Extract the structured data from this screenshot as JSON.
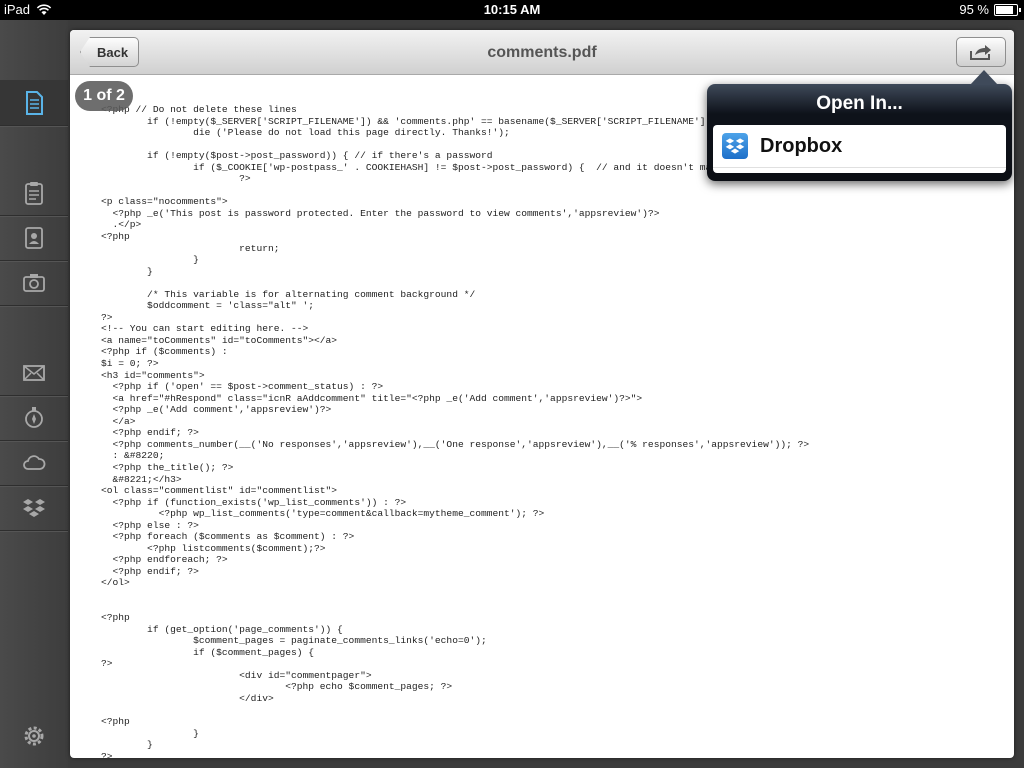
{
  "status_bar": {
    "device": "iPad",
    "time": "10:15 AM",
    "battery": "95 %",
    "battery_level": 0.95
  },
  "sidebar": {
    "items": [
      "document-icon",
      "clipboard-icon",
      "contacts-icon",
      "camera-icon",
      "mail-icon",
      "compass-icon",
      "cloud-icon",
      "dropbox-icon",
      "gear-icon"
    ]
  },
  "nav": {
    "back_label": "Back",
    "title": "comments.pdf",
    "action_icon": "share-icon"
  },
  "viewer": {
    "page_indicator": "1 of 2"
  },
  "popover": {
    "title": "Open In...",
    "items": [
      {
        "label": "Dropbox",
        "icon": "dropbox-icon"
      }
    ]
  },
  "document": {
    "lines": [
      "<?php // Do not delete these lines",
      "        if (!empty($_SERVER['SCRIPT_FILENAME']) && 'comments.php' == basename($_SERVER['SCRIPT_FILENAME']))",
      "                die ('Please do not load this page directly. Thanks!');",
      "",
      "        if (!empty($post->post_password)) { // if there's a password",
      "                if ($_COOKIE['wp-postpass_' . COOKIEHASH] != $post->post_password) {  // and it doesn't match the cookie",
      "                        ?>",
      "",
      "<p class=\"nocomments\">",
      "  <?php _e('This post is password protected. Enter the password to view comments','appsreview')?>",
      "  .</p>",
      "<?php",
      "                        return;",
      "                }",
      "        }",
      "",
      "        /* This variable is for alternating comment background */",
      "        $oddcomment = 'class=\"alt\" ';",
      "?>",
      "<!-- You can start editing here. -->",
      "<a name=\"toComments\" id=\"toComments\"></a>",
      "<?php if ($comments) :",
      "$i = 0; ?>",
      "<h3 id=\"comments\">",
      "  <?php if ('open' == $post->comment_status) : ?>",
      "  <a href=\"#hRespond\" class=\"icnR aAddcomment\" title=\"<?php _e('Add comment','appsreview')?>\">",
      "  <?php _e('Add comment','appsreview')?>",
      "  </a>",
      "  <?php endif; ?>",
      "  <?php comments_number(__('No responses','appsreview'),__('One response','appsreview'),__('% responses','appsreview')); ?>",
      "  : &#8220;",
      "  <?php the_title(); ?>",
      "  &#8221;</h3>",
      "<ol class=\"commentlist\" id=\"commentlist\">",
      "  <?php if (function_exists('wp_list_comments')) : ?>",
      "          <?php wp_list_comments('type=comment&callback=mytheme_comment'); ?>",
      "  <?php else : ?>",
      "  <?php foreach ($comments as $comment) : ?>",
      "        <?php listcomments($comment);?>",
      "  <?php endforeach; ?>",
      "  <?php endif; ?>",
      "</ol>",
      "",
      "",
      "<?php",
      "        if (get_option('page_comments')) {",
      "                $comment_pages = paginate_comments_links('echo=0');",
      "                if ($comment_pages) {",
      "?>",
      "                        <div id=\"commentpager\">",
      "                                <?php echo $comment_pages; ?>",
      "                        </div>",
      "",
      "<?php",
      "                }",
      "        }",
      "?>"
    ]
  }
}
